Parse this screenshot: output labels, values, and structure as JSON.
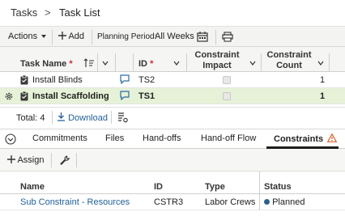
{
  "breadcrumb": {
    "parent": "Tasks",
    "separator": ">",
    "current": "Task List"
  },
  "toolbar": {
    "actions_label": "Actions",
    "add_label": "Add",
    "planning_period_label": "Planning Period:",
    "planning_period_value": "All Weeks"
  },
  "grid": {
    "columns": {
      "task_name": "Task Name",
      "id": "ID",
      "constraint_impact_line1": "Constraint",
      "constraint_impact_line2": "Impact",
      "constraint_count_line1": "Constraint",
      "constraint_count_line2": "Count"
    },
    "rows": [
      {
        "task_name": "Install Blinds",
        "id": "TS2",
        "constraint_count": "1",
        "selected": false
      },
      {
        "task_name": "Install Scaffolding",
        "id": "TS1",
        "constraint_count": "1",
        "selected": true
      }
    ]
  },
  "footer": {
    "total_text": "Total: 4",
    "download_label": "Download"
  },
  "tabs": {
    "items": [
      "Commitments",
      "Files",
      "Hand-offs",
      "Hand-off Flow",
      "Constraints"
    ],
    "active": "Constraints"
  },
  "constraints": {
    "assign_label": "Assign",
    "columns": {
      "name": "Name",
      "id": "ID",
      "type": "Type",
      "status": "Status"
    },
    "rows": [
      {
        "name": "Sub Constraint - Resources",
        "id": "CSTR3",
        "type": "Labor Crews",
        "status": "Planned"
      }
    ]
  },
  "colors": {
    "selected_row": "#e6f2d8",
    "required_marker": "#d0282f",
    "link": "#1f5f99",
    "warning": "#d4602a",
    "status_planned": "#2e5f8a"
  },
  "icons": {
    "actions_caret": "chevron-down-icon",
    "add": "plus-icon",
    "calendar": "calendar-icon",
    "print": "print-icon",
    "sort": "sort-icon",
    "task_type": "clipboard-icon",
    "comment": "comment-icon",
    "row_settings": "gear-icon",
    "download": "download-icon",
    "export": "export-settings-icon",
    "collapse": "collapse-icon",
    "warning": "warning-icon",
    "wrench": "wrench-icon"
  }
}
